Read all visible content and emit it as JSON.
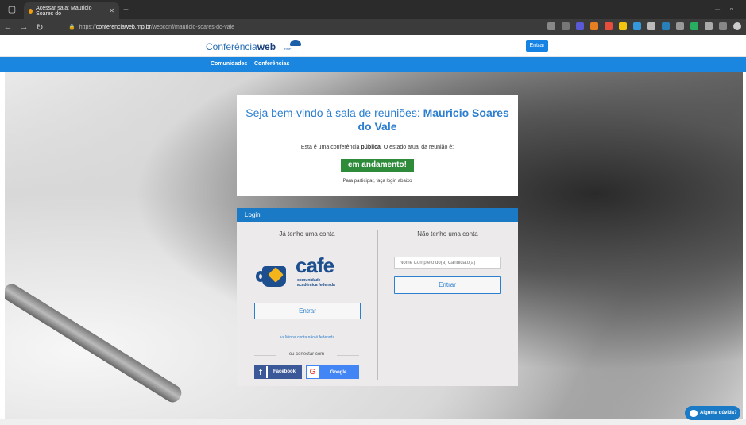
{
  "browser": {
    "tab_title": "Acessar sala: Mauricio Soares do",
    "url_prefix": "https://",
    "url_host": "conferenciaweb.rnp.br",
    "url_path": "/webconf/mauricio-soares-do-vale",
    "colors": {
      "chrome_dark": "#2b2b2b",
      "chrome": "#3b3b3b"
    }
  },
  "header": {
    "logo_prefix": "Conferência",
    "logo_bold": "web",
    "rnp_logo_text": "RNP",
    "entrar_label": "Entrar"
  },
  "nav": {
    "items": [
      {
        "label": "Comunidades"
      },
      {
        "label": "Conferências"
      }
    ],
    "color": "#1a86e0"
  },
  "welcome": {
    "title_prefix": "Seja bem-vindo à sala de reuniões: ",
    "room_name": "Mauricio Soares do Vale",
    "state_prefix": "Esta é uma conferência ",
    "state_type": "pública",
    "state_suffix": ". O estado atual da reunião é:",
    "status": "em andamento!",
    "status_color": "#2e8b3a",
    "instruction": "Para participar, faça login abaixo"
  },
  "login": {
    "heading": "Login",
    "left": {
      "heading": "Já tenho uma conta",
      "cafe_word": "cafe",
      "cafe_sub_1": "comunidade",
      "cafe_sub_2": "acadêmica federada",
      "entrar_label": "Entrar",
      "not_federated_link": ">> Minha conta não é federada",
      "connect_label": "ou conectar com",
      "facebook_label": "Facebook",
      "google_label": "Google"
    },
    "right": {
      "heading": "Não tenho uma conta",
      "name_placeholder": "Nome Completo do(a) Candidato(a)",
      "entrar_label": "Entrar"
    }
  },
  "help": {
    "label": "Alguma dúvida?"
  }
}
